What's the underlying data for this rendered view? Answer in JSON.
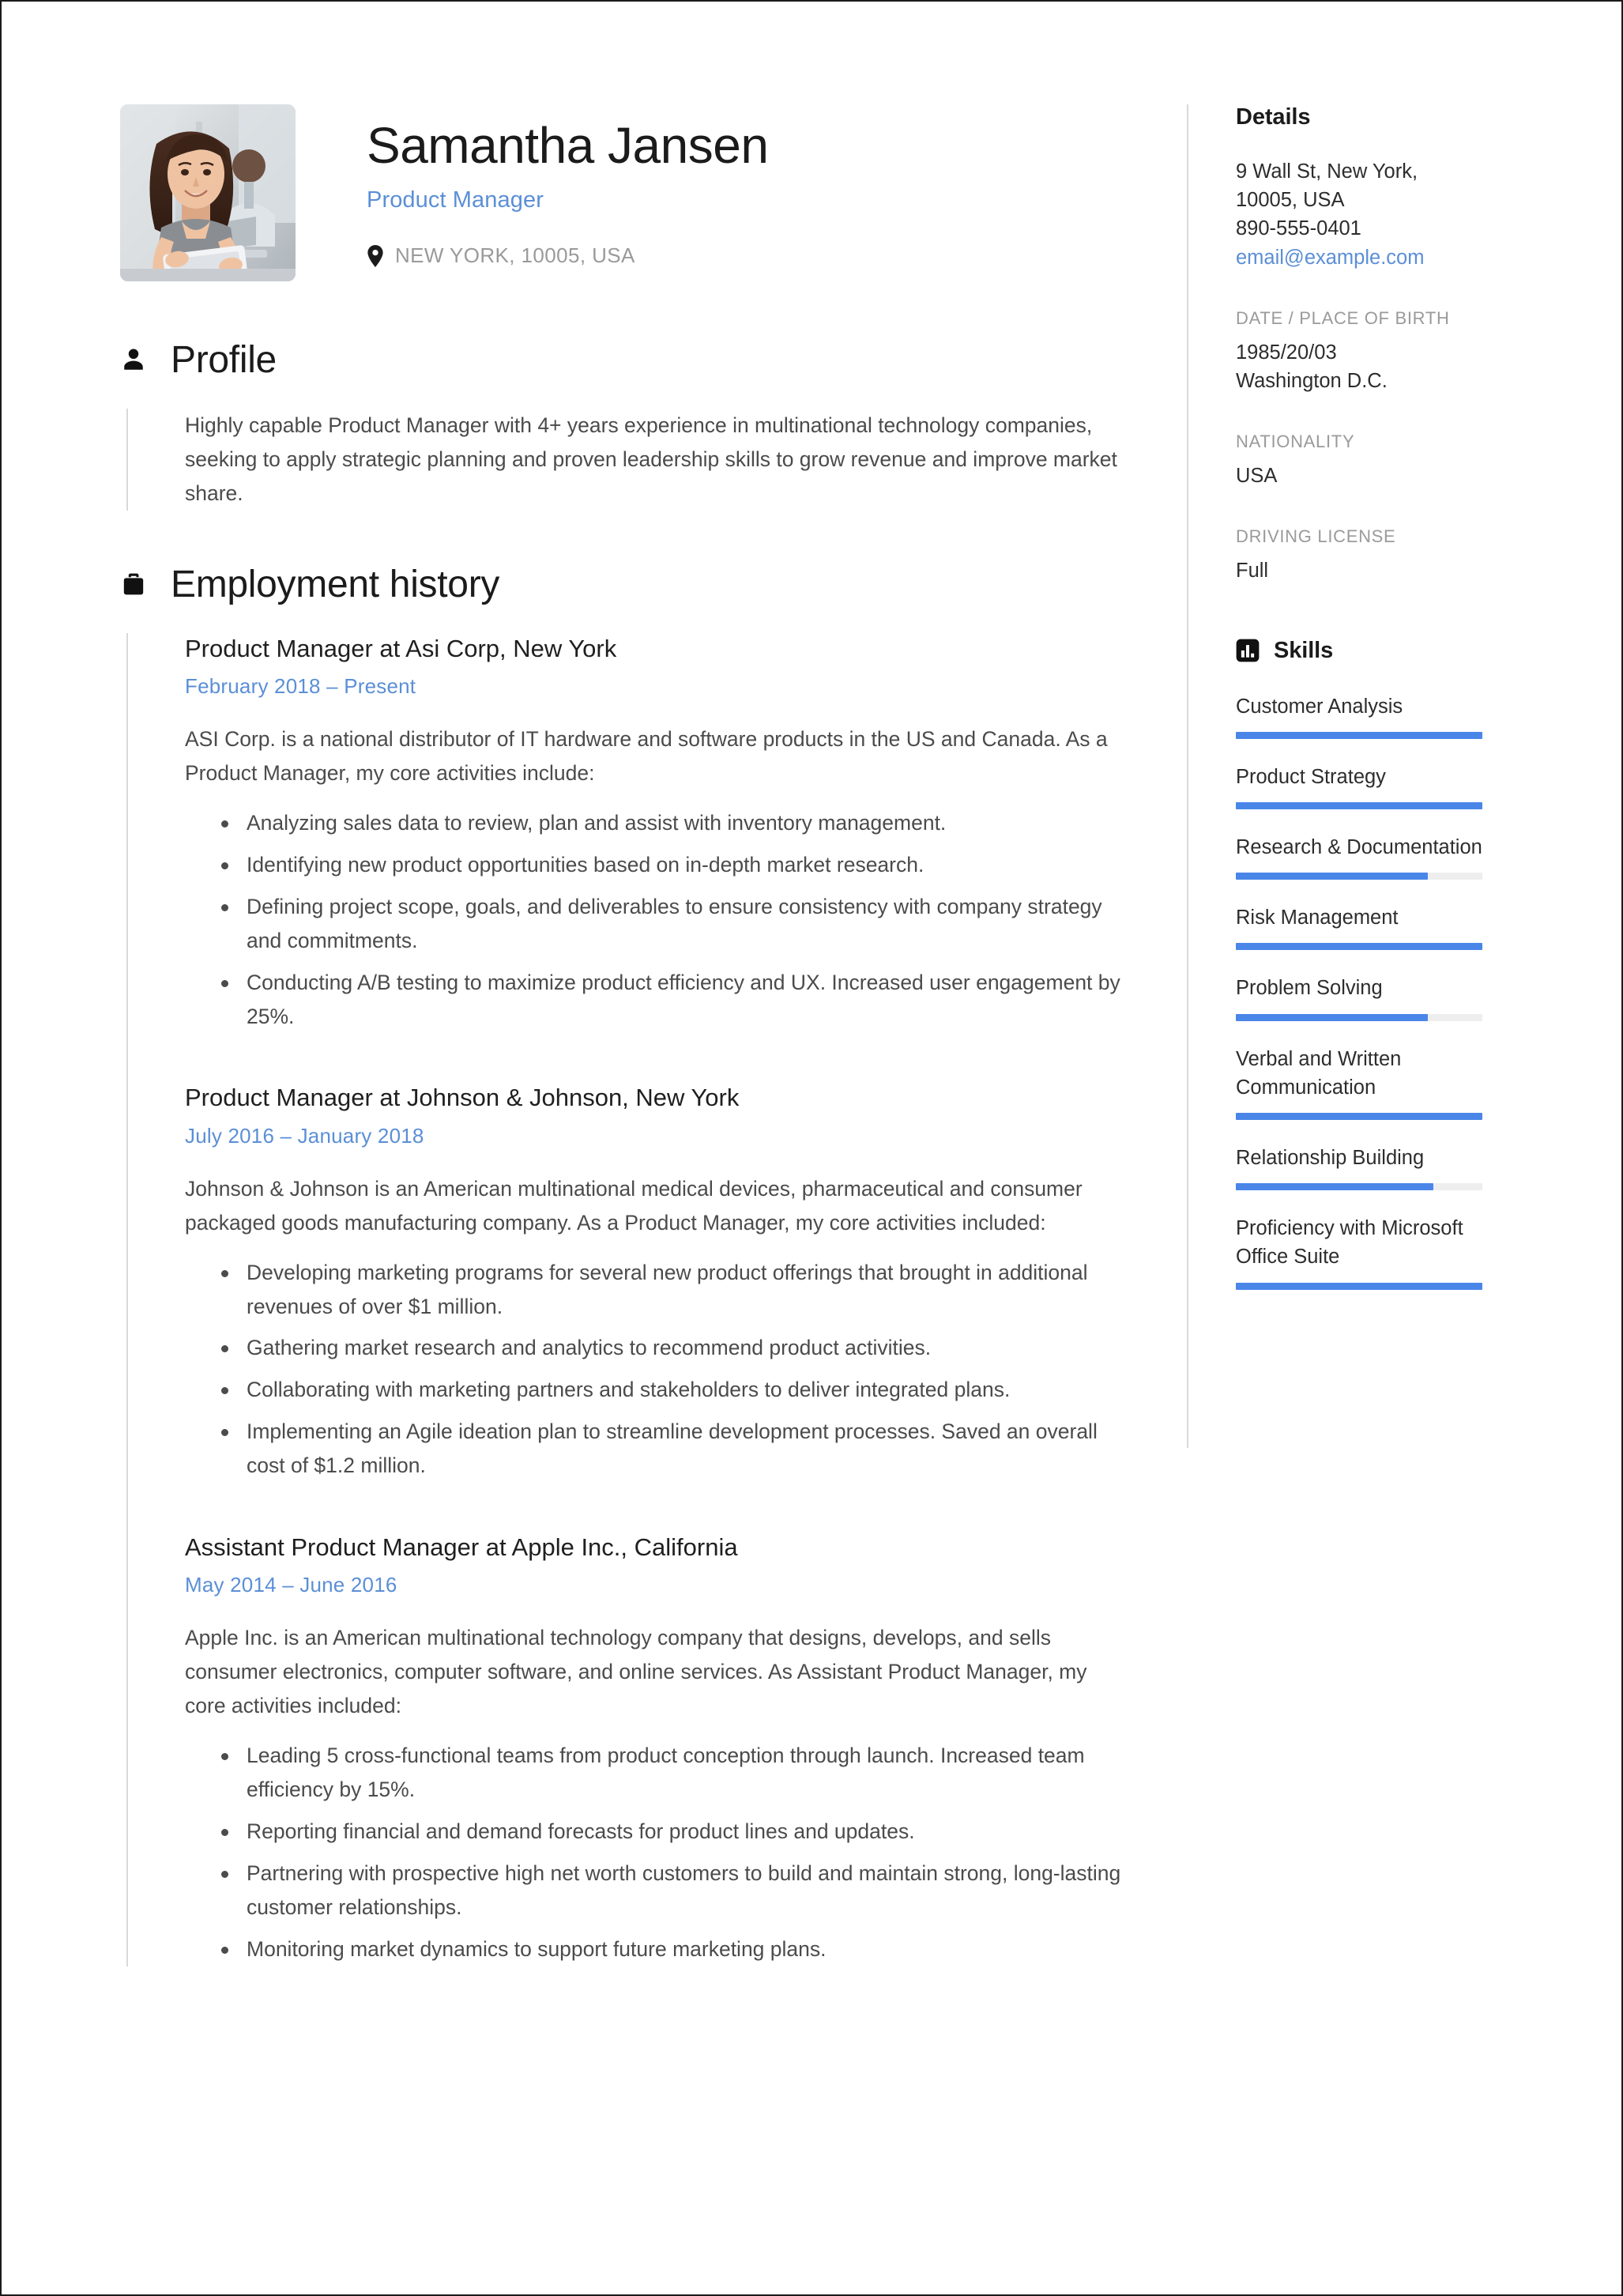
{
  "header": {
    "name": "Samantha Jansen",
    "job_title": "Product Manager",
    "location": "NEW YORK, 10005, USA",
    "pin_icon": "map-pin-icon",
    "avatar_alt": "portrait-photo"
  },
  "accent_color": "#5b8fd6",
  "bar_color": "#4a86e8",
  "sections": {
    "profile": {
      "icon": "person-icon",
      "title": "Profile",
      "text": "Highly capable Product Manager with 4+ years experience in multinational technology companies, seeking to apply strategic planning and proven leadership skills to grow revenue and improve market share."
    },
    "employment": {
      "icon": "briefcase-icon",
      "title": "Employment history",
      "jobs": [
        {
          "heading": "Product Manager at Asi Corp, New York",
          "dates": "February 2018  –  Present",
          "description": "ASI Corp. is a national distributor of IT hardware and software products in the US and Canada. As a Product Manager, my core activities include:",
          "bullets": [
            "Analyzing sales data to review, plan and assist with inventory management.",
            "Identifying new product opportunities based on in-depth market research.",
            "Defining project scope, goals, and deliverables to ensure consistency with company strategy and commitments.",
            "Conducting A/B testing to maximize product efficiency and UX. Increased user engagement by 25%."
          ]
        },
        {
          "heading": "Product Manager at Johnson & Johnson, New York",
          "dates": "July 2016  –  January 2018",
          "description": "Johnson & Johnson is an American multinational medical devices, pharmaceutical and consumer packaged goods manufacturing company. As a Product Manager, my core activities included:",
          "bullets": [
            "Developing marketing programs for several new product offerings that brought in additional revenues of over $1 million.",
            "Gathering market research and analytics to recommend product activities.",
            "Collaborating with marketing partners and stakeholders to deliver integrated plans.",
            "Implementing an Agile ideation plan to streamline development processes. Saved an overall cost of $1.2 million."
          ]
        },
        {
          "heading": "Assistant Product Manager at Apple Inc., California",
          "dates": "May 2014  –  June 2016",
          "description": "Apple Inc. is an American multinational technology company that designs, develops, and sells consumer electronics, computer software, and online services. As Assistant Product Manager, my core activities included:",
          "bullets": [
            "Leading 5 cross-functional teams from product conception through launch. Increased team efficiency by 15%.",
            "Reporting financial and demand forecasts for product lines and updates.",
            "Partnering with prospective high net worth customers to build and maintain strong, long-lasting customer relationships.",
            "Monitoring market dynamics to support future marketing plans."
          ]
        }
      ]
    }
  },
  "sidebar": {
    "details": {
      "title": "Details",
      "address_line1": "9 Wall St, New York,",
      "address_line2": "10005, USA",
      "phone": "890-555-0401",
      "email": "email@example.com",
      "groups": [
        {
          "label": "DATE / PLACE OF BIRTH",
          "value_line1": "1985/20/03",
          "value_line2": "Washington D.C."
        },
        {
          "label": "NATIONALITY",
          "value_line1": "USA",
          "value_line2": ""
        },
        {
          "label": "DRIVING LICENSE",
          "value_line1": "Full",
          "value_line2": ""
        }
      ]
    },
    "skills": {
      "icon": "bar-chart-icon",
      "title": "Skills",
      "items": [
        {
          "name": "Customer Analysis",
          "level": 100
        },
        {
          "name": "Product Strategy",
          "level": 100
        },
        {
          "name": "Research & Documentation",
          "level": 78
        },
        {
          "name": "Risk Management",
          "level": 100
        },
        {
          "name": "Problem Solving",
          "level": 78
        },
        {
          "name": "Verbal and Written Communication",
          "level": 100
        },
        {
          "name": "Relationship Building",
          "level": 80
        },
        {
          "name": "Proficiency with Microsoft Office Suite",
          "level": 100
        }
      ]
    }
  }
}
